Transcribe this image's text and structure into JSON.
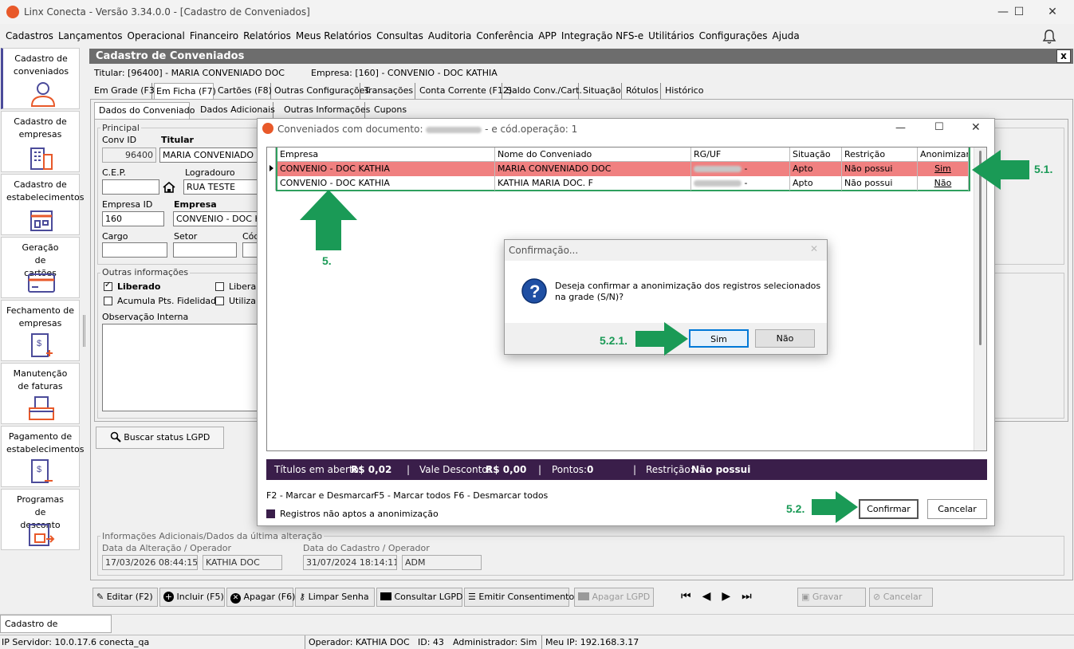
{
  "window": {
    "title": "Linx Conecta - Versão 3.34.0.0 - [Cadastro de Conveniados]",
    "min": "—",
    "max": "☐",
    "close": "✕"
  },
  "menu": [
    "Cadastros",
    "Lançamentos",
    "Operacional",
    "Financeiro",
    "Relatórios",
    "Meus Relatórios",
    "Consultas",
    "Auditoria",
    "Conferência",
    "APP",
    "Integração NFS-e",
    "Utilitários",
    "Configurações",
    "Ajuda"
  ],
  "sidebar": [
    {
      "label": "Cadastro de conveniados"
    },
    {
      "label": "Cadastro de empresas"
    },
    {
      "label": "Cadastro de estabelecimentos"
    },
    {
      "label": "Geração de cartões"
    },
    {
      "label": "Fechamento de empresas"
    },
    {
      "label": "Manutenção de faturas"
    },
    {
      "label": "Pagamento de estabelecimentos"
    },
    {
      "label": "Programas de desconto"
    }
  ],
  "form": {
    "title": "Cadastro de Conveniados",
    "close": "x",
    "titular": "Titular: [96400] - MARIA CONVENIADO DOC",
    "empresa": "Empresa: [160] - CONVENIO -  DOC KATHIA",
    "tabs": [
      "Em Grade (F3)",
      "Em Ficha (F7)",
      "Cartões (F8)",
      "Outras Configurações",
      "Transações",
      "Conta Corrente (F12)",
      "Saldo Conv./Cart.",
      "Situação",
      "Rótulos",
      "Histórico"
    ],
    "subtabs": [
      "Dados do Conveniado",
      "Dados Adicionais",
      "Outras Informações",
      "Cupons"
    ],
    "principal": "Principal",
    "conv_id_label": "Conv ID",
    "conv_id": "96400",
    "titular_label": "Titular",
    "titular_value": "MARIA CONVENIADO D",
    "cep_label": "C.E.P.",
    "logradouro_label": "Logradouro",
    "logradouro": "RUA TESTE",
    "empresa_id_label": "Empresa ID",
    "empresa_id": "160",
    "empresa_label": "Empresa",
    "empresa_value": "CONVENIO - DOC K",
    "cargo_label": "Cargo",
    "setor_label": "Setor",
    "cod_label": "Cód",
    "outras": "Outras informações",
    "liberado": "Liberado",
    "acumula": "Acumula Pts. Fidelidade",
    "libera": "Libera v",
    "utiliza": "Utiliza V",
    "obs": "Observação Interna",
    "buscar": "Buscar status LGPD",
    "info_adic": "Informações Adicionais/Dados da última alteração",
    "data_alt_label": "Data da Alteração / Operador",
    "data_alt": "17/03/2026 08:44:15",
    "op_alt": "KATHIA DOC",
    "data_cad_label": "Data do Cadastro / Operador",
    "data_cad": "31/07/2024 18:14:11",
    "op_cad": "ADM"
  },
  "dialog": {
    "title_pre": "Conveniados com documento:",
    "title_post": "- e cód.operação: 1",
    "columns": [
      "Empresa",
      "Nome do Conveniado",
      "RG/UF",
      "Situação",
      "Restrição",
      "Anonimizar"
    ],
    "rows": [
      {
        "empresa": "CONVENIO -  DOC KATHIA",
        "nome": "MARIA CONVENIADO DOC",
        "rg_suffix": "-",
        "situacao": "Apto",
        "restricao": "Não possui",
        "anonimizar": "Sim"
      },
      {
        "empresa": "CONVENIO -  DOC KATHIA",
        "nome": "KATHIA MARIA DOC. F",
        "rg_suffix": "-",
        "situacao": "Apto",
        "restricao": "Não possui",
        "anonimizar": "Não"
      }
    ],
    "status": {
      "titulos_label": "Títulos em aberto:",
      "titulos": "R$ 0,02",
      "vale_label": "Vale Desconto:",
      "vale": "R$ 0,00",
      "pontos_label": "Pontos:",
      "pontos": "0",
      "restricao_label": "Restrição:",
      "restricao": "Não possui",
      "sep": "|"
    },
    "hint_f2": "F2 - Marcar e Desmarcar",
    "hint_f5": "F5 - Marcar todos",
    "hint_f6": "F6 - Desmarcar todos",
    "legend": "Registros não aptos a anonimização",
    "confirmar": "Confirmar",
    "cancelar": "Cancelar"
  },
  "confirm": {
    "title": "Confirmação...",
    "message1": "Deseja confirmar a anonimização dos registros selecionados",
    "message2": "na grade (S/N)?",
    "yes": "Sim",
    "no": "Não",
    "close": "✕"
  },
  "annotations": {
    "a5": "5.",
    "a51": "5.1.",
    "a52": "5.2.",
    "a521": "5.2.1."
  },
  "toolbar": [
    "Editar (F2)",
    "Incluir (F5)",
    "Apagar (F6)",
    "Limpar Senha",
    "Consultar LGPD",
    "Emitir Consentimento",
    "Apagar LGPD",
    "Gravar",
    "Cancelar"
  ],
  "taskbar": {
    "item": "Cadastro de Conveniados"
  },
  "statusbar": {
    "servidor": "IP Servidor: 10.0.17.6 conecta_qa",
    "operador": "Operador: KATHIA DOC",
    "id": "ID: 43",
    "admin": "Administrador: Sim",
    "ip": "Meu IP: 192.168.3.17"
  },
  "colors": {
    "accent": "#e8592a",
    "dialog_status": "#3a1e4a",
    "row_highlight": "#f08080",
    "arrow": "#1a9a56"
  }
}
